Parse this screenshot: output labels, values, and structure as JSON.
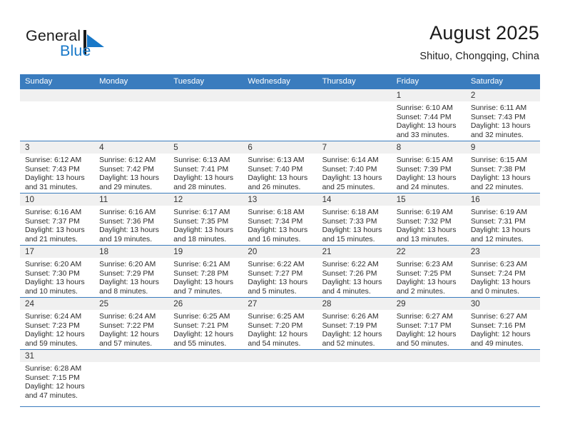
{
  "brand": {
    "word_one": "General",
    "word_two": "Blue",
    "mark_icon": "flag-triangle-icon",
    "accent_color": "#1878c8"
  },
  "header": {
    "title": "August 2025",
    "subtitle": "Shituo, Chongqing, China"
  },
  "calendar": {
    "header_color": "#3a7cbe",
    "weekdays": [
      "Sunday",
      "Monday",
      "Tuesday",
      "Wednesday",
      "Thursday",
      "Friday",
      "Saturday"
    ],
    "weeks": [
      [
        {
          "empty": true
        },
        {
          "empty": true
        },
        {
          "empty": true
        },
        {
          "empty": true
        },
        {
          "empty": true
        },
        {
          "day": "1",
          "sunrise": "Sunrise: 6:10 AM",
          "sunset": "Sunset: 7:44 PM",
          "daylight1": "Daylight: 13 hours",
          "daylight2": "and 33 minutes."
        },
        {
          "day": "2",
          "sunrise": "Sunrise: 6:11 AM",
          "sunset": "Sunset: 7:43 PM",
          "daylight1": "Daylight: 13 hours",
          "daylight2": "and 32 minutes."
        }
      ],
      [
        {
          "day": "3",
          "sunrise": "Sunrise: 6:12 AM",
          "sunset": "Sunset: 7:43 PM",
          "daylight1": "Daylight: 13 hours",
          "daylight2": "and 31 minutes."
        },
        {
          "day": "4",
          "sunrise": "Sunrise: 6:12 AM",
          "sunset": "Sunset: 7:42 PM",
          "daylight1": "Daylight: 13 hours",
          "daylight2": "and 29 minutes."
        },
        {
          "day": "5",
          "sunrise": "Sunrise: 6:13 AM",
          "sunset": "Sunset: 7:41 PM",
          "daylight1": "Daylight: 13 hours",
          "daylight2": "and 28 minutes."
        },
        {
          "day": "6",
          "sunrise": "Sunrise: 6:13 AM",
          "sunset": "Sunset: 7:40 PM",
          "daylight1": "Daylight: 13 hours",
          "daylight2": "and 26 minutes."
        },
        {
          "day": "7",
          "sunrise": "Sunrise: 6:14 AM",
          "sunset": "Sunset: 7:40 PM",
          "daylight1": "Daylight: 13 hours",
          "daylight2": "and 25 minutes."
        },
        {
          "day": "8",
          "sunrise": "Sunrise: 6:15 AM",
          "sunset": "Sunset: 7:39 PM",
          "daylight1": "Daylight: 13 hours",
          "daylight2": "and 24 minutes."
        },
        {
          "day": "9",
          "sunrise": "Sunrise: 6:15 AM",
          "sunset": "Sunset: 7:38 PM",
          "daylight1": "Daylight: 13 hours",
          "daylight2": "and 22 minutes."
        }
      ],
      [
        {
          "day": "10",
          "sunrise": "Sunrise: 6:16 AM",
          "sunset": "Sunset: 7:37 PM",
          "daylight1": "Daylight: 13 hours",
          "daylight2": "and 21 minutes."
        },
        {
          "day": "11",
          "sunrise": "Sunrise: 6:16 AM",
          "sunset": "Sunset: 7:36 PM",
          "daylight1": "Daylight: 13 hours",
          "daylight2": "and 19 minutes."
        },
        {
          "day": "12",
          "sunrise": "Sunrise: 6:17 AM",
          "sunset": "Sunset: 7:35 PM",
          "daylight1": "Daylight: 13 hours",
          "daylight2": "and 18 minutes."
        },
        {
          "day": "13",
          "sunrise": "Sunrise: 6:18 AM",
          "sunset": "Sunset: 7:34 PM",
          "daylight1": "Daylight: 13 hours",
          "daylight2": "and 16 minutes."
        },
        {
          "day": "14",
          "sunrise": "Sunrise: 6:18 AM",
          "sunset": "Sunset: 7:33 PM",
          "daylight1": "Daylight: 13 hours",
          "daylight2": "and 15 minutes."
        },
        {
          "day": "15",
          "sunrise": "Sunrise: 6:19 AM",
          "sunset": "Sunset: 7:32 PM",
          "daylight1": "Daylight: 13 hours",
          "daylight2": "and 13 minutes."
        },
        {
          "day": "16",
          "sunrise": "Sunrise: 6:19 AM",
          "sunset": "Sunset: 7:31 PM",
          "daylight1": "Daylight: 13 hours",
          "daylight2": "and 12 minutes."
        }
      ],
      [
        {
          "day": "17",
          "sunrise": "Sunrise: 6:20 AM",
          "sunset": "Sunset: 7:30 PM",
          "daylight1": "Daylight: 13 hours",
          "daylight2": "and 10 minutes."
        },
        {
          "day": "18",
          "sunrise": "Sunrise: 6:20 AM",
          "sunset": "Sunset: 7:29 PM",
          "daylight1": "Daylight: 13 hours",
          "daylight2": "and 8 minutes."
        },
        {
          "day": "19",
          "sunrise": "Sunrise: 6:21 AM",
          "sunset": "Sunset: 7:28 PM",
          "daylight1": "Daylight: 13 hours",
          "daylight2": "and 7 minutes."
        },
        {
          "day": "20",
          "sunrise": "Sunrise: 6:22 AM",
          "sunset": "Sunset: 7:27 PM",
          "daylight1": "Daylight: 13 hours",
          "daylight2": "and 5 minutes."
        },
        {
          "day": "21",
          "sunrise": "Sunrise: 6:22 AM",
          "sunset": "Sunset: 7:26 PM",
          "daylight1": "Daylight: 13 hours",
          "daylight2": "and 4 minutes."
        },
        {
          "day": "22",
          "sunrise": "Sunrise: 6:23 AM",
          "sunset": "Sunset: 7:25 PM",
          "daylight1": "Daylight: 13 hours",
          "daylight2": "and 2 minutes."
        },
        {
          "day": "23",
          "sunrise": "Sunrise: 6:23 AM",
          "sunset": "Sunset: 7:24 PM",
          "daylight1": "Daylight: 13 hours",
          "daylight2": "and 0 minutes."
        }
      ],
      [
        {
          "day": "24",
          "sunrise": "Sunrise: 6:24 AM",
          "sunset": "Sunset: 7:23 PM",
          "daylight1": "Daylight: 12 hours",
          "daylight2": "and 59 minutes."
        },
        {
          "day": "25",
          "sunrise": "Sunrise: 6:24 AM",
          "sunset": "Sunset: 7:22 PM",
          "daylight1": "Daylight: 12 hours",
          "daylight2": "and 57 minutes."
        },
        {
          "day": "26",
          "sunrise": "Sunrise: 6:25 AM",
          "sunset": "Sunset: 7:21 PM",
          "daylight1": "Daylight: 12 hours",
          "daylight2": "and 55 minutes."
        },
        {
          "day": "27",
          "sunrise": "Sunrise: 6:25 AM",
          "sunset": "Sunset: 7:20 PM",
          "daylight1": "Daylight: 12 hours",
          "daylight2": "and 54 minutes."
        },
        {
          "day": "28",
          "sunrise": "Sunrise: 6:26 AM",
          "sunset": "Sunset: 7:19 PM",
          "daylight1": "Daylight: 12 hours",
          "daylight2": "and 52 minutes."
        },
        {
          "day": "29",
          "sunrise": "Sunrise: 6:27 AM",
          "sunset": "Sunset: 7:17 PM",
          "daylight1": "Daylight: 12 hours",
          "daylight2": "and 50 minutes."
        },
        {
          "day": "30",
          "sunrise": "Sunrise: 6:27 AM",
          "sunset": "Sunset: 7:16 PM",
          "daylight1": "Daylight: 12 hours",
          "daylight2": "and 49 minutes."
        }
      ],
      [
        {
          "day": "31",
          "sunrise": "Sunrise: 6:28 AM",
          "sunset": "Sunset: 7:15 PM",
          "daylight1": "Daylight: 12 hours",
          "daylight2": "and 47 minutes."
        },
        {
          "empty": true
        },
        {
          "empty": true
        },
        {
          "empty": true
        },
        {
          "empty": true
        },
        {
          "empty": true
        },
        {
          "empty": true
        }
      ]
    ]
  }
}
